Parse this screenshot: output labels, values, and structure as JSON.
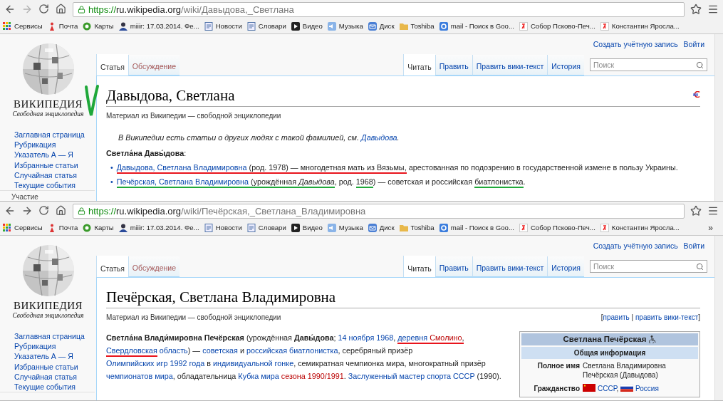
{
  "windows": [
    {
      "address": {
        "scheme": "https://",
        "host": "ru.wikipedia.org",
        "path": "/wiki/Давыдова,_Светлана"
      },
      "bookmarks": [
        {
          "kind": "apps",
          "label": "Сервисы"
        },
        {
          "kind": "figure",
          "label": "Почта"
        },
        {
          "kind": "map",
          "label": "Карты"
        },
        {
          "kind": "user",
          "label": "miiir: 17.03.2014. Фе..."
        },
        {
          "kind": "doc",
          "label": "Новости"
        },
        {
          "kind": "doc",
          "label": "Словари"
        },
        {
          "kind": "video",
          "label": "Видео"
        },
        {
          "kind": "music",
          "label": "Музыка"
        },
        {
          "kind": "disk",
          "label": "Диск"
        },
        {
          "kind": "folder",
          "label": "Toshiba"
        },
        {
          "kind": "google",
          "label": "mail - Поиск в Goo..."
        },
        {
          "kind": "yandex",
          "label": "Собор Псково-Печ..."
        },
        {
          "kind": "yandex",
          "label": "Константин Яросла..."
        }
      ],
      "personal": [
        "Создать учётную запись",
        "Войти"
      ],
      "logo": {
        "wordmark": "ВИКИПЕДИЯ",
        "tagline": "Свободная энциклопедия"
      },
      "sidebar": {
        "items": [
          "Заглавная страница",
          "Рубрикация",
          "Указатель А — Я",
          "Избранные статьи",
          "Случайная статья",
          "Текущие события"
        ],
        "section": "Участие"
      },
      "left_tabs": [
        {
          "label": "Статья",
          "selected": true,
          "kind": "plain"
        },
        {
          "label": "Обсуждение",
          "selected": false,
          "kind": "new"
        }
      ],
      "right_tabs": [
        {
          "label": "Читать",
          "selected": true
        },
        {
          "label": "Править",
          "selected": false
        },
        {
          "label": "Править вики-текст",
          "selected": false
        },
        {
          "label": "История",
          "selected": false
        }
      ],
      "search": {
        "placeholder": "Поиск"
      },
      "check_mark": {
        "color": "#1fa83a"
      },
      "article": {
        "kind": "disambiguation",
        "title": "Давыдова, Светлана",
        "tagline": "Материал из Википедии — свободной энциклопедии",
        "hatnote": [
          {
            "kind": "italic",
            "text": "В Википедии есть статьи о других людях с такой фамилией, см. "
          },
          {
            "kind": "link",
            "text": "Давыдова"
          },
          {
            "kind": "italic",
            "text": "."
          }
        ],
        "lead": [
          {
            "kind": "bold",
            "text": "Светла́на Давы́дова"
          },
          {
            "kind": "plain",
            "text": ":"
          }
        ],
        "items": [
          {
            "marker": "•",
            "segments": [
              {
                "kind": "link",
                "text": "Давыдова, Светлана Владимировна",
                "color": "#e8141c"
              },
              {
                "kind": "plain",
                "text": " (род. 1978) — многодетная мать из Вязьмы,",
                "color": "#e8141c"
              },
              {
                "kind": "plain",
                "text": " арестованная по подозрению в государственной измене в пользу Украины."
              }
            ]
          },
          {
            "marker": "•",
            "segments": [
              {
                "kind": "link",
                "text": "Печёрская, Светлана Владимировна",
                "color": "#1fa83a"
              },
              {
                "kind": "plain",
                "text": " (урождённая ",
                "color": "#1fa83a"
              },
              {
                "kind": "italic",
                "text": "Давыдова",
                "color": "#1fa83a"
              },
              {
                "kind": "plain",
                "text": ", род. "
              },
              {
                "kind": "plain",
                "text": "1968",
                "color": "#1fa83a"
              },
              {
                "kind": "plain",
                "text": ") — советская и российская "
              },
              {
                "kind": "plain",
                "text": "биатлонистка",
                "color": "#1fa83a"
              },
              {
                "kind": "plain",
                "text": "."
              }
            ]
          }
        ]
      }
    },
    {
      "address": {
        "scheme": "https://",
        "host": "ru.wikipedia.org",
        "path": "/wiki/Печёрская,_Светлана_Владимировна"
      },
      "bookmarks": [
        {
          "kind": "apps",
          "label": "Сервисы"
        },
        {
          "kind": "figure",
          "label": "Почта"
        },
        {
          "kind": "map",
          "label": "Карты"
        },
        {
          "kind": "user",
          "label": "miiir: 17.03.2014. Фе..."
        },
        {
          "kind": "doc",
          "label": "Новости"
        },
        {
          "kind": "doc",
          "label": "Словари"
        },
        {
          "kind": "video",
          "label": "Видео"
        },
        {
          "kind": "music",
          "label": "Музыка"
        },
        {
          "kind": "disk",
          "label": "Диск"
        },
        {
          "kind": "folder",
          "label": "Toshiba"
        },
        {
          "kind": "google",
          "label": "mail - Поиск в Goo..."
        },
        {
          "kind": "yandex",
          "label": "Собор Псково-Печ..."
        },
        {
          "kind": "yandex",
          "label": "Константин Яросла..."
        }
      ],
      "bookmarks_more": "»",
      "personal": [
        "Создать учётную запись",
        "Войти"
      ],
      "logo": {
        "wordmark": "ВИКИПЕДИЯ",
        "tagline": "Свободная энциклопедия"
      },
      "sidebar": {
        "items": [
          "Заглавная страница",
          "Рубрикация",
          "Указатель А — Я",
          "Избранные статьи",
          "Случайная статья",
          "Текущие события"
        ]
      },
      "left_tabs": [
        {
          "label": "Статья",
          "selected": true,
          "kind": "plain"
        },
        {
          "label": "Обсуждение",
          "selected": false,
          "kind": "new"
        }
      ],
      "right_tabs": [
        {
          "label": "Читать",
          "selected": true
        },
        {
          "label": "Править",
          "selected": false
        },
        {
          "label": "Править вики-текст",
          "selected": false
        },
        {
          "label": "История",
          "selected": false
        }
      ],
      "search": {
        "placeholder": "Поиск"
      },
      "article": {
        "kind": "article",
        "title": "Печёрская, Светлана Владимировна",
        "tagline": "Материал из Википедии — свободной энциклопедии",
        "edit_links": [
          {
            "kind": "plain",
            "text": "["
          },
          {
            "kind": "link",
            "text": "править"
          },
          {
            "kind": "plain",
            "text": " | "
          },
          {
            "kind": "link",
            "text": "править вики-текст"
          },
          {
            "kind": "plain",
            "text": "]"
          }
        ],
        "lead": [
          {
            "kind": "bold",
            "text": "Светла́на Влади́мировна Печёрская"
          },
          {
            "kind": "plain",
            "text": " (урождённая "
          },
          {
            "kind": "bold",
            "text": "Давы́дова"
          },
          {
            "kind": "plain",
            "text": "; "
          },
          {
            "kind": "link",
            "text": "14 ноября"
          },
          {
            "kind": "link",
            "text": " 1968"
          },
          {
            "kind": "plain",
            "text": ", "
          },
          {
            "kind": "link",
            "text": "деревня",
            "color": "#e8141c"
          },
          {
            "kind": "redlink",
            "text": " Смолино",
            "color": "#e8141c"
          },
          {
            "kind": "plain",
            "text": ", ",
            "color": "#e8141c"
          },
          {
            "kind": "link",
            "text": "Свердловская",
            "color": "#e8141c"
          },
          {
            "kind": "link",
            "text": " область"
          },
          {
            "kind": "plain",
            "text": ") — "
          },
          {
            "kind": "link",
            "text": "советская"
          },
          {
            "kind": "plain",
            "text": " и "
          },
          {
            "kind": "link",
            "text": "российская"
          },
          {
            "kind": "link",
            "text": " биатлонистка"
          },
          {
            "kind": "plain",
            "text": ", серебряный призёр "
          },
          {
            "kind": "link",
            "text": "Олимпийских игр 1992 года"
          },
          {
            "kind": "plain",
            "text": " в "
          },
          {
            "kind": "link",
            "text": "индивидуальной гонке"
          },
          {
            "kind": "plain",
            "text": ", семикратная чемпионка мира, многократный призёр "
          },
          {
            "kind": "link",
            "text": "чемпионатов мира"
          },
          {
            "kind": "plain",
            "text": ", обладательница "
          },
          {
            "kind": "link",
            "text": "Кубка мира"
          },
          {
            "kind": "redlink",
            "text": " сезона 1990/1991"
          },
          {
            "kind": "plain",
            "text": ". "
          },
          {
            "kind": "link",
            "text": "Заслуженный мастер спорта СССР"
          },
          {
            "kind": "plain",
            "text": " (1990)."
          }
        ],
        "infobox": {
          "title": "Светлана Печёрская",
          "header": "Общая информация",
          "rows": [
            {
              "label": "Полное имя",
              "value": [
                {
                  "kind": "plain",
                  "text": "Светлана Владимировна Печёрская (Давыдова)"
                }
              ]
            },
            {
              "label": "Гражданство",
              "value": [
                {
                  "kind": "flag_ussr"
                },
                {
                  "kind": "link",
                  "text": "СССР"
                },
                {
                  "kind": "plain",
                  "text": ", "
                },
                {
                  "kind": "flag_russia"
                },
                {
                  "kind": "link",
                  "text": "Россия"
                }
              ]
            }
          ]
        }
      }
    }
  ]
}
